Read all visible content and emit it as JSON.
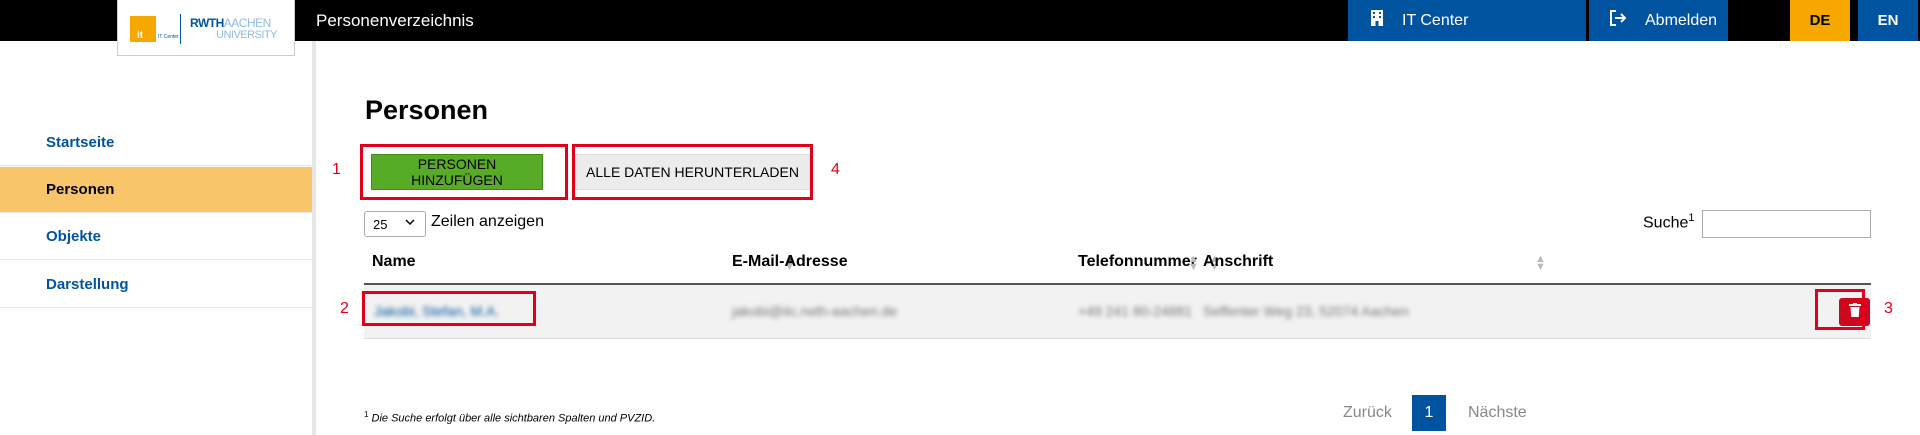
{
  "header": {
    "app_title": "Personenverzeichnis",
    "logo": {
      "it_text": "it",
      "it_center": "IT Center",
      "rwth": "RWTH",
      "aachen": "AACHEN",
      "university": "UNIVERSITY"
    },
    "it_center_label": "IT Center",
    "logout_label": "Abmelden",
    "lang_de": "DE",
    "lang_en": "EN"
  },
  "sidebar": {
    "items": [
      {
        "label": "Startseite",
        "active": false
      },
      {
        "label": "Personen",
        "active": true
      },
      {
        "label": "Objekte",
        "active": false
      },
      {
        "label": "Darstellung",
        "active": false
      }
    ]
  },
  "main": {
    "title": "Personen",
    "add_button": "PERSONEN HINZUFÜGEN",
    "download_button": "ALLE DATEN HERUNTERLADEN",
    "page_length": "25",
    "page_length_label": "Zeilen anzeigen",
    "search_label": "Suche",
    "search_footnote_mark": "1",
    "search_value": "",
    "table": {
      "columns": [
        "Name",
        "E-Mail-Adresse",
        "Telefonnummer",
        "Anschrift"
      ],
      "rows": [
        {
          "name": "Jakobi, Stefan, M.A.",
          "email": "jakobi@itc.rwth-aachen.de",
          "phone": "+49 241 80-24881",
          "address": "Seffenter Weg 23, 52074 Aachen"
        }
      ]
    },
    "pagination": {
      "prev": "Zurück",
      "current": "1",
      "next": "Nächste"
    },
    "footnote": {
      "mark": "1",
      "text": " Die Suche erfolgt über alle sichtbaren Spalten und PVZID."
    }
  },
  "annotations": [
    "1",
    "2",
    "3",
    "4"
  ],
  "colors": {
    "rwth_blue": "#00549f",
    "gold": "#f6a800",
    "green": "#57ab27",
    "red": "#cc071e",
    "annotation": "#e0001b"
  }
}
